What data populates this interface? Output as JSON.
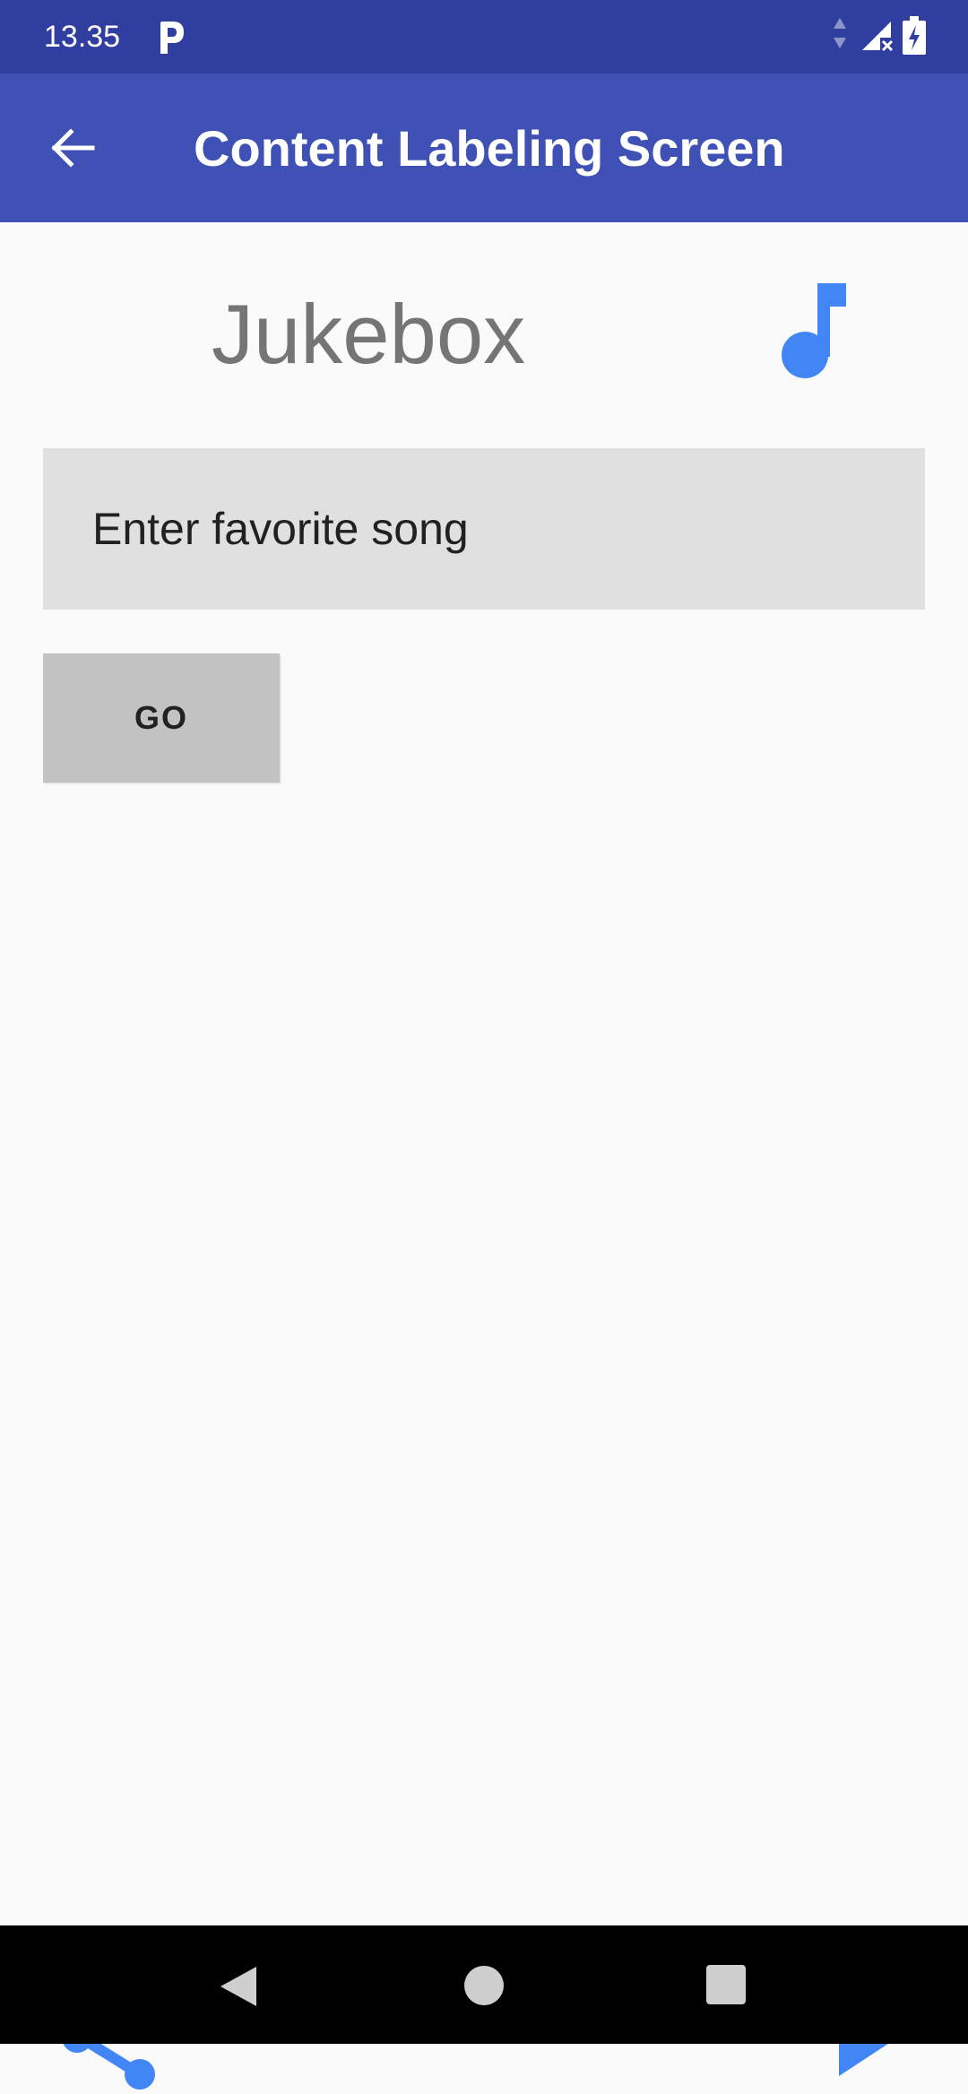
{
  "status_bar": {
    "time": "13.35",
    "icons": [
      "parking-icon",
      "data-arrows-icon",
      "signal-icon",
      "battery-charging-icon"
    ]
  },
  "app_bar": {
    "title": "Content Labeling Screen",
    "back_icon": "arrow-back-icon"
  },
  "main": {
    "heading": "Jukebox",
    "heading_icon": "music-note-icon",
    "song_input": {
      "value": "",
      "placeholder": "Enter favorite song"
    },
    "go_button_label": "GO"
  },
  "bottom_actions": {
    "share_icon": "share-icon",
    "play_icon": "play-icon"
  },
  "navigation_bar": {
    "icons": [
      "nav-back-icon",
      "nav-home-icon",
      "nav-recents-icon"
    ]
  },
  "colors": {
    "status_bar": "#303f9f",
    "app_bar": "#3f51b5",
    "accent": "#4285f4",
    "input_background": "#e0e0e0",
    "button_background": "#c2c2c2",
    "heading_text": "#757575",
    "background": "#fafafa"
  }
}
